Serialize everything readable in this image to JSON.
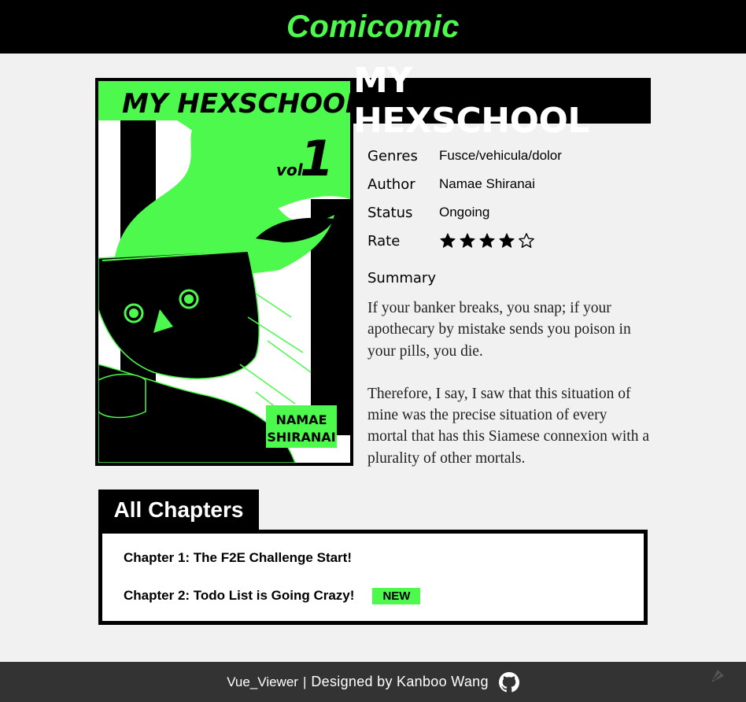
{
  "header": {
    "brand": "Comicomic"
  },
  "cover": {
    "title_art": "MY HEXSCHOOL",
    "vol_label": "vol.",
    "vol_number": "1",
    "author_tag_line1": "NAMAE",
    "author_tag_line2": "SHIRANAI",
    "accent_color": "#4cf94c"
  },
  "comic": {
    "title": "MY HEXSCHOOL",
    "meta": [
      {
        "key": "Genres",
        "value": "Fusce/vehicula/dolor"
      },
      {
        "key": "Author",
        "value": "Namae Shiranai"
      },
      {
        "key": "Status",
        "value": "Ongoing"
      }
    ],
    "rate": {
      "key": "Rate",
      "stars": 4,
      "max": 5
    },
    "summary_heading": "Summary",
    "summary": [
      "If your banker breaks, you snap; if your apothecary by mistake sends you poison in your pills, you die.",
      "Therefore, I say, I saw that this situation of mine was the precise situation of every mortal that has this Siamese connexion with a plurality of other mortals."
    ]
  },
  "chapters": {
    "heading": "All Chapters",
    "items": [
      {
        "title": "Chapter 1: The F2E Challenge Start!",
        "badge": ""
      },
      {
        "title": "Chapter 2: Todo List is Going Crazy!",
        "badge": "NEW"
      }
    ]
  },
  "footer": {
    "app_name": "Vue_Viewer",
    "separator": "|",
    "credit": "Designed by Kanboo Wang",
    "icon": "github-icon"
  },
  "corner": {
    "icon": "feather-icon"
  }
}
